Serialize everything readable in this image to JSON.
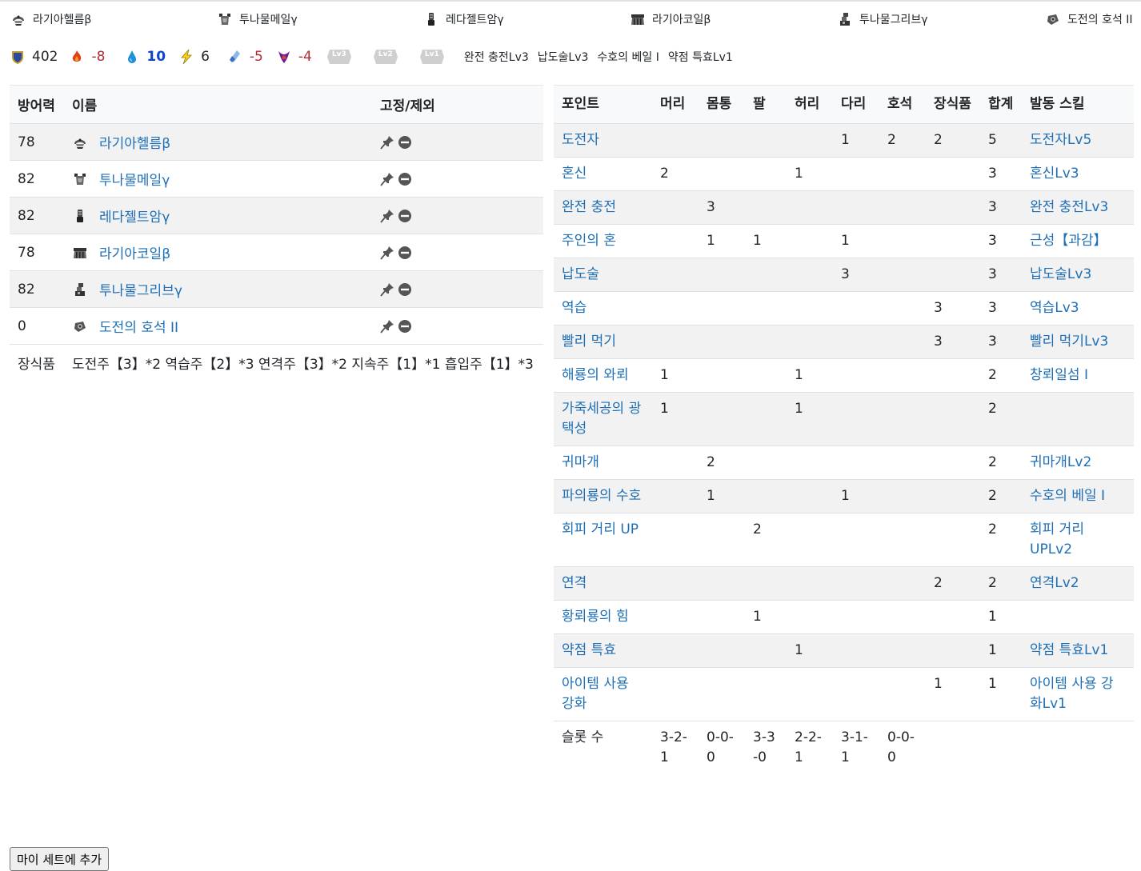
{
  "equipment": [
    {
      "icon": "helmet-icon",
      "name": "라기아헬름β"
    },
    {
      "icon": "chest-armor-icon",
      "name": "투나물메일γ"
    },
    {
      "icon": "arm-armor-icon",
      "name": "레다젤트암γ"
    },
    {
      "icon": "waist-armor-icon",
      "name": "라기아코일β"
    },
    {
      "icon": "leg-armor-icon",
      "name": "투나물그리브γ"
    },
    {
      "icon": "talisman-icon",
      "name": "도전의 호석 II"
    }
  ],
  "stats": {
    "defense": "402",
    "fire": "-8",
    "water": "10",
    "thunder": "6",
    "ice": "-5",
    "dragon": "-4"
  },
  "free_slots": [
    "Lv3",
    "Lv2",
    "Lv1"
  ],
  "active_skills_summary": [
    "완전 충전Lv3",
    "납도술Lv3",
    "수호의 베일 I",
    "약점 특효Lv1"
  ],
  "left_table": {
    "headers": {
      "defense": "방어력",
      "name": "이름",
      "fix": "고정/제외"
    },
    "rows": [
      {
        "defense": "78",
        "icon": "helmet-icon",
        "name": "라기아헬름β"
      },
      {
        "defense": "82",
        "icon": "chest-armor-icon",
        "name": "투나물메일γ"
      },
      {
        "defense": "82",
        "icon": "arm-armor-icon",
        "name": "레다젤트암γ"
      },
      {
        "defense": "78",
        "icon": "waist-armor-icon",
        "name": "라기아코일β"
      },
      {
        "defense": "82",
        "icon": "leg-armor-icon",
        "name": "투나물그리브γ"
      },
      {
        "defense": "0",
        "icon": "talisman-icon",
        "name": "도전의 호석 II"
      }
    ],
    "decorations": {
      "label": "장식품",
      "value": "도전주【3】*2 역습주【2】*3 연격주【3】*2 지속주【1】*1 흡입주【1】*3"
    }
  },
  "right_table": {
    "headers": [
      "포인트",
      "머리",
      "몸통",
      "팔",
      "허리",
      "다리",
      "호석",
      "장식품",
      "합계",
      "발동 스킬"
    ],
    "rows": [
      [
        "도전자",
        "",
        "",
        "",
        "",
        "1",
        "2",
        "2",
        "5",
        "도전자Lv5"
      ],
      [
        "혼신",
        "2",
        "",
        "",
        "1",
        "",
        "",
        "",
        "3",
        "혼신Lv3"
      ],
      [
        "완전 충전",
        "",
        "3",
        "",
        "",
        "",
        "",
        "",
        "3",
        "완전 충전Lv3"
      ],
      [
        "주인의 혼",
        "",
        "1",
        "1",
        "",
        "1",
        "",
        "",
        "3",
        "근성【과감】"
      ],
      [
        "납도술",
        "",
        "",
        "",
        "",
        "3",
        "",
        "",
        "3",
        "납도술Lv3"
      ],
      [
        "역습",
        "",
        "",
        "",
        "",
        "",
        "",
        "3",
        "3",
        "역습Lv3"
      ],
      [
        "빨리 먹기",
        "",
        "",
        "",
        "",
        "",
        "",
        "3",
        "3",
        "빨리 먹기Lv3"
      ],
      [
        "해룡의 와뢰",
        "1",
        "",
        "",
        "1",
        "",
        "",
        "",
        "2",
        "창뢰일섬 I"
      ],
      [
        "가죽세공의 광택성",
        "1",
        "",
        "",
        "1",
        "",
        "",
        "",
        "2",
        ""
      ],
      [
        "귀마개",
        "",
        "2",
        "",
        "",
        "",
        "",
        "",
        "2",
        "귀마개Lv2"
      ],
      [
        "파의룡의 수호",
        "",
        "1",
        "",
        "",
        "1",
        "",
        "",
        "2",
        "수호의 베일 I"
      ],
      [
        "회피 거리 UP",
        "",
        "",
        "2",
        "",
        "",
        "",
        "",
        "2",
        "회피 거리 UPLv2"
      ],
      [
        "연격",
        "",
        "",
        "",
        "",
        "",
        "",
        "2",
        "2",
        "연격Lv2"
      ],
      [
        "황뢰룡의 힘",
        "",
        "",
        "1",
        "",
        "",
        "",
        "",
        "1",
        ""
      ],
      [
        "약점 특효",
        "",
        "",
        "",
        "1",
        "",
        "",
        "",
        "1",
        "약점 특효Lv1"
      ],
      [
        "아이템 사용 강화",
        "",
        "",
        "",
        "",
        "",
        "",
        "1",
        "1",
        "아이템 사용 강화Lv1"
      ]
    ],
    "slots": {
      "label": "슬롯 수",
      "values": [
        "3-2-1",
        "0-0-0",
        "3-3-0",
        "2-2-1",
        "3-1-1",
        "0-0-0"
      ]
    }
  },
  "add_button_label": "마이 세트에 추가",
  "colors": {
    "link": "#1e6fb6",
    "negative": "#b02a37",
    "water": "#0d47c9"
  }
}
